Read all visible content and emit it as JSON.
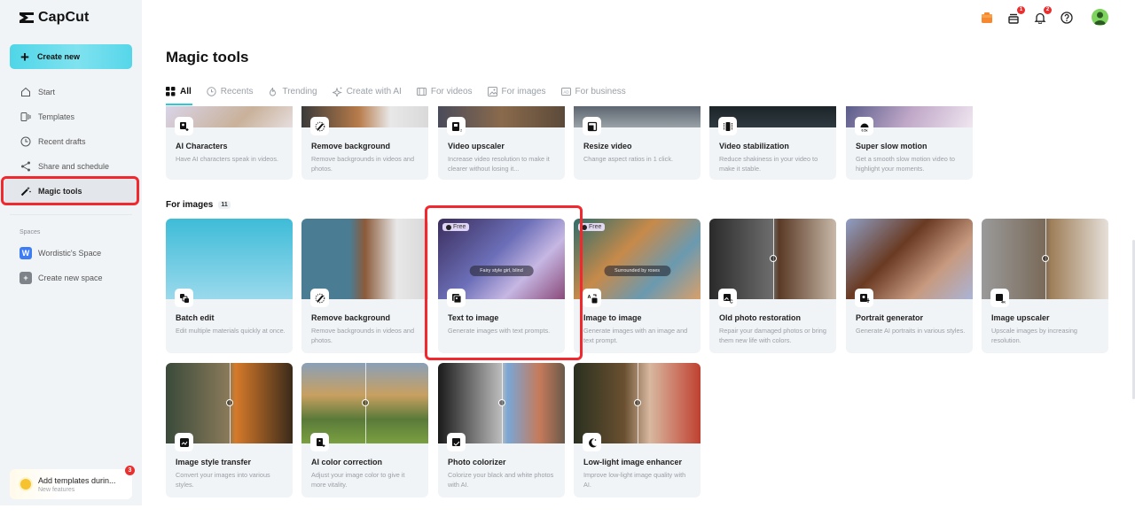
{
  "app": {
    "name": "CapCut"
  },
  "sidebar": {
    "create_new_label": "Create new",
    "nav": [
      {
        "label": "Start",
        "icon": "home-icon"
      },
      {
        "label": "Templates",
        "icon": "templates-icon"
      },
      {
        "label": "Recent drafts",
        "icon": "clock-icon"
      },
      {
        "label": "Share and schedule",
        "icon": "share-icon"
      },
      {
        "label": "Magic tools",
        "icon": "magic-wand-icon",
        "active": true
      }
    ],
    "spaces_label": "Spaces",
    "spaces": [
      {
        "label": "Wordistic's Space",
        "badge": "W",
        "color": "#3e7cf6"
      },
      {
        "label": "Create new space",
        "badge": "+",
        "color": "#7d8389"
      }
    ],
    "notice": {
      "title": "Add templates durin...",
      "subtitle": "New features",
      "badge": "3"
    }
  },
  "header": {
    "icons": [
      {
        "name": "gift-icon"
      },
      {
        "name": "inbox-icon",
        "badge": "1"
      },
      {
        "name": "bell-icon",
        "badge": "2"
      },
      {
        "name": "help-icon"
      },
      {
        "name": "avatar"
      }
    ]
  },
  "main": {
    "title": "Magic tools",
    "tabs": [
      {
        "label": "All",
        "icon": "grid-icon",
        "active": true
      },
      {
        "label": "Recents",
        "icon": "clock-icon"
      },
      {
        "label": "Trending",
        "icon": "flame-icon"
      },
      {
        "label": "Create with AI",
        "icon": "sparkle-icon"
      },
      {
        "label": "For videos",
        "icon": "film-icon"
      },
      {
        "label": "For images",
        "icon": "image-icon"
      },
      {
        "label": "For business",
        "icon": "ad-icon"
      }
    ],
    "video_tools": [
      {
        "title": "AI Characters",
        "desc": "Have AI characters speak in videos.",
        "icon": "ai-character-icon"
      },
      {
        "title": "Remove background",
        "desc": "Remove backgrounds in videos and photos.",
        "icon": "remove-bg-icon"
      },
      {
        "title": "Video upscaler",
        "desc": "Increase video resolution to make it clearer without losing it...",
        "icon": "video-upscale-icon"
      },
      {
        "title": "Resize video",
        "desc": "Change aspect ratios in 1 click.",
        "icon": "resize-icon"
      },
      {
        "title": "Video stabilization",
        "desc": "Reduce shakiness in your video to make it stable.",
        "icon": "stabilize-icon"
      },
      {
        "title": "Super slow motion",
        "desc": "Get a smooth slow motion video to highlight your moments.",
        "icon": "slow-motion-icon"
      }
    ],
    "images_section": {
      "label": "For images",
      "count": "11"
    },
    "image_tools": [
      {
        "title": "Batch edit",
        "desc": "Edit multiple materials quickly at once.",
        "icon": "batch-edit-icon"
      },
      {
        "title": "Remove background",
        "desc": "Remove backgrounds in videos and photos.",
        "icon": "remove-bg-icon"
      },
      {
        "title": "Text to image",
        "desc": "Generate images with text prompts.",
        "icon": "text-to-image-icon",
        "badge": "Free",
        "prompt": "Fairy style girl, blind",
        "highlighted": true
      },
      {
        "title": "Image to image",
        "desc": "Generate images with an image and text prompt.",
        "icon": "image-to-image-icon",
        "badge": "Free",
        "prompt": "Surrounded by roses"
      },
      {
        "title": "Old photo restoration",
        "desc": "Repair your damaged photos or bring them new life with colors.",
        "icon": "photo-restore-icon"
      },
      {
        "title": "Portrait generator",
        "desc": "Generate AI portraits in various styles.",
        "icon": "portrait-icon"
      },
      {
        "title": "Image upscaler",
        "desc": "Upscale images by increasing resolution.",
        "icon": "image-upscale-icon"
      },
      {
        "title": "Image style transfer",
        "desc": "Convert your images into various styles.",
        "icon": "style-transfer-icon"
      },
      {
        "title": "AI color correction",
        "desc": "Adjust your image color to give it more vitality.",
        "icon": "color-correction-icon"
      },
      {
        "title": "Photo colorizer",
        "desc": "Colorize your black and white photos with AI.",
        "icon": "colorizer-icon"
      },
      {
        "title": "Low-light image enhancer",
        "desc": "Improve low-light image quality with AI.",
        "icon": "low-light-icon"
      }
    ]
  }
}
